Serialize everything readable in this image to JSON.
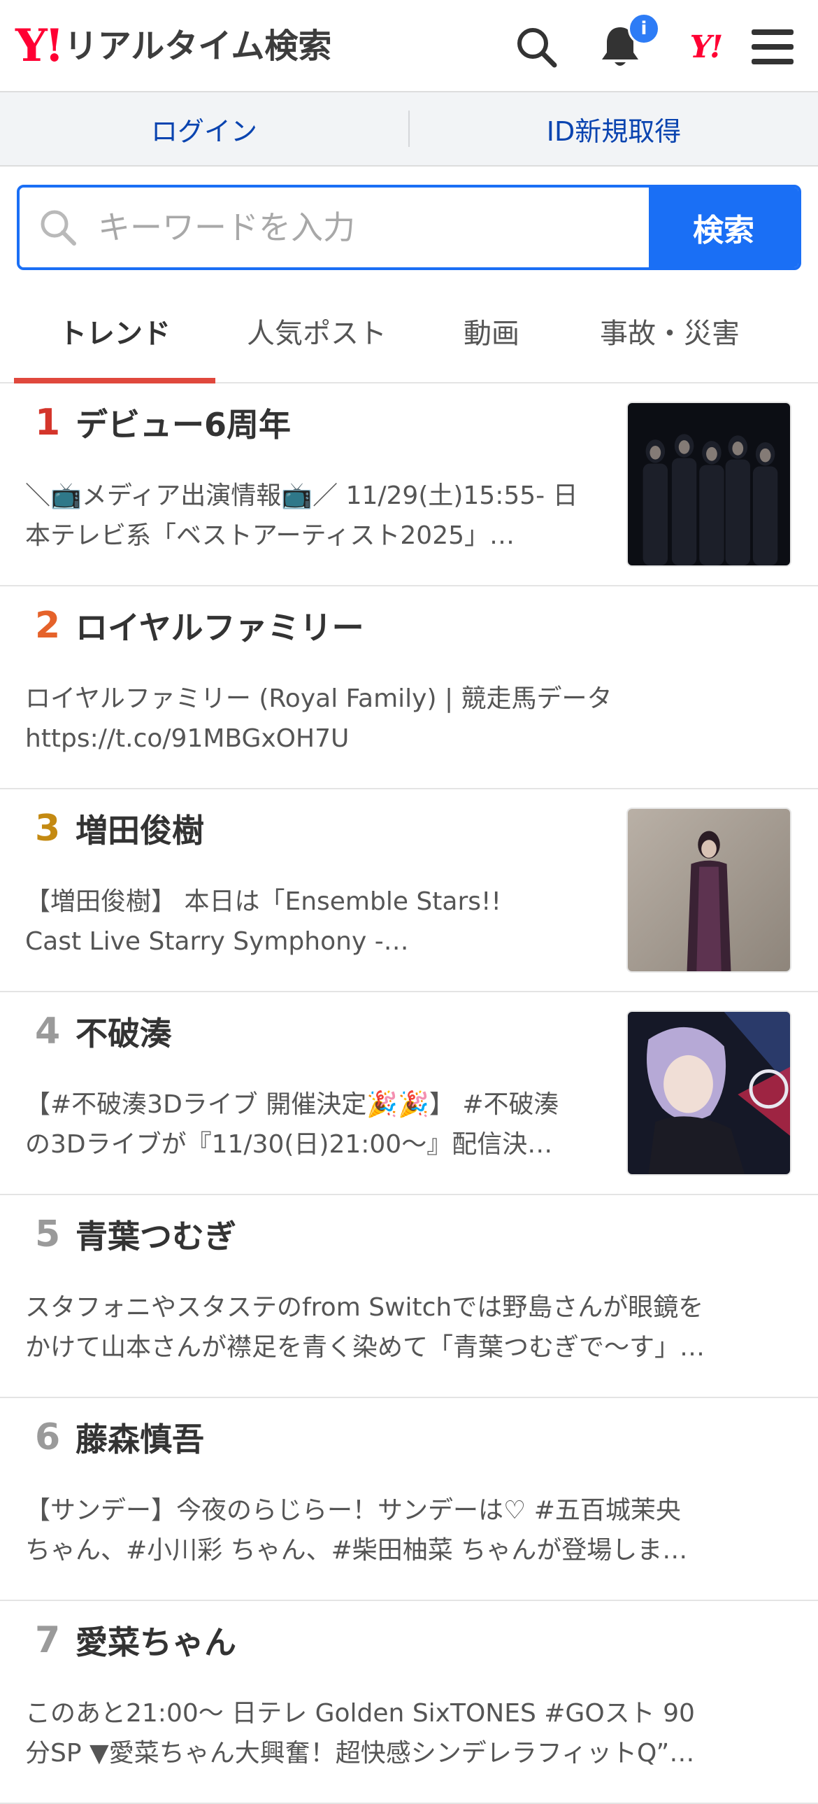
{
  "header": {
    "logo_mark": "Y!",
    "logo_text": "リアルタイム検索",
    "notification_badge": "i",
    "yj_logo": "Y!"
  },
  "loginbar": {
    "login": "ログイン",
    "register": "ID新規取得"
  },
  "search": {
    "placeholder": "キーワードを入力",
    "button": "検索"
  },
  "tabs": [
    "トレンド",
    "人気ポスト",
    "動画",
    "事故・災害"
  ],
  "trends": [
    {
      "rank": "1",
      "rank_color": "#d4352b",
      "title": "デビュー6周年",
      "line1": "＼📺メディア出演情報📺／ 11/29(土)15:55- 日",
      "line2": "本テレビ系「ベストアーティスト2025」…",
      "thumb": "group-photo"
    },
    {
      "rank": "2",
      "rank_color": "#e5622a",
      "title": "ロイヤルファミリー",
      "line1": "ロイヤルファミリー (Royal Family) | 競走馬データ",
      "line2": "https://t.co/91MBGxOH7U",
      "thumb": ""
    },
    {
      "rank": "3",
      "rank_color": "#c48a12",
      "title": "増田俊樹",
      "line1": "【増田俊樹】 本日は「Ensemble Stars!!",
      "line2": "Cast Live Starry Symphony -…",
      "thumb": "person-photo"
    },
    {
      "rank": "4",
      "rank_color": "#9a9a9a",
      "title": "不破湊",
      "line1": "【#不破湊3Dライブ 開催決定🎉🎉】 #不破湊",
      "line2": "の3Dライブが『11/30(日)21:00〜』配信決…",
      "thumb": "anime-art"
    },
    {
      "rank": "5",
      "rank_color": "#9a9a9a",
      "title": "青葉つむぎ",
      "line1": "スタフォニやスタステのfrom Switchでは野島さんが眼鏡を",
      "line2": "かけて山本さんが襟足を青く染めて「青葉つむぎで〜す」…",
      "thumb": ""
    },
    {
      "rank": "6",
      "rank_color": "#9a9a9a",
      "title": "藤森慎吾",
      "line1": "【サンデー】今夜のらじらー！サンデーは♡ #五百城茉央",
      "line2": "ちゃん、#小川彩 ちゃん、#柴田柚菜 ちゃんが登場しま…",
      "thumb": ""
    },
    {
      "rank": "7",
      "rank_color": "#9a9a9a",
      "title": "愛菜ちゃん",
      "line1": "このあと21:00〜 日テレ Golden SixTONES #GOスト 90",
      "line2": "分SP ▼愛菜ちゃん大興奮！超快感シンデレラフィットQ”…",
      "thumb": ""
    }
  ]
}
